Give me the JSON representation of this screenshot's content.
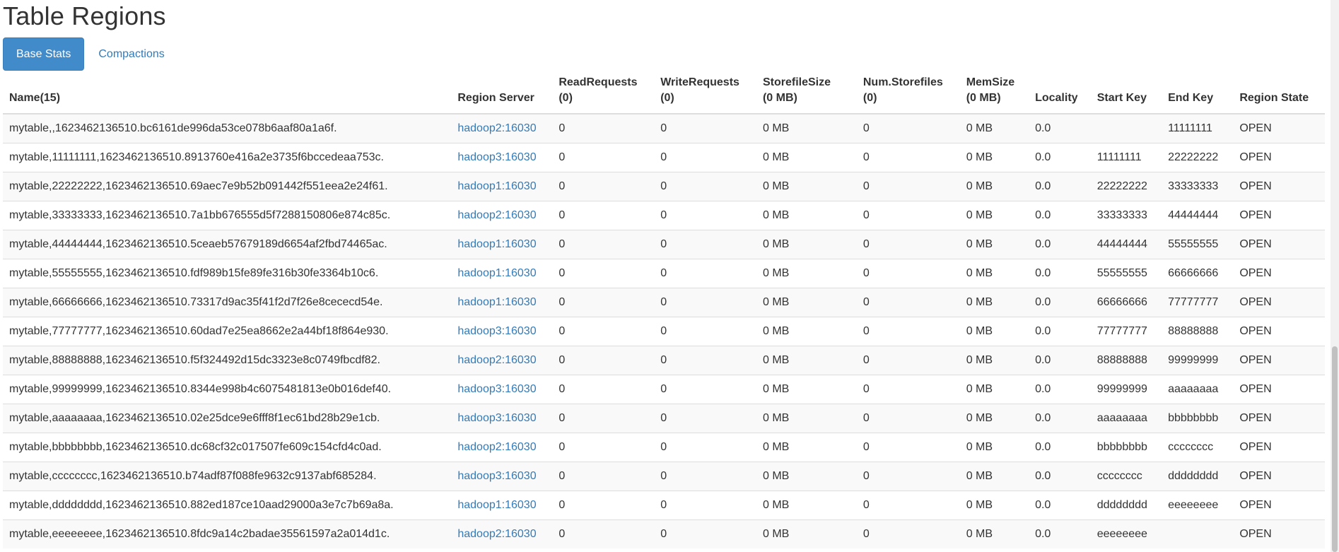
{
  "page": {
    "title": "Table Regions"
  },
  "tabs": [
    {
      "label": "Base Stats",
      "active": true
    },
    {
      "label": "Compactions",
      "active": false
    }
  ],
  "table": {
    "headers": {
      "name": "Name(15)",
      "server": "Region Server",
      "read_title": "ReadRequests",
      "read_sub": "(0)",
      "write_title": "WriteRequests",
      "write_sub": "(0)",
      "sfsize_title": "StorefileSize",
      "sfsize_sub": "(0 MB)",
      "numsf_title": "Num.Storefiles",
      "numsf_sub": "(0)",
      "mem_title": "MemSize",
      "mem_sub": "(0 MB)",
      "locality": "Locality",
      "start_key": "Start Key",
      "end_key": "End Key",
      "state": "Region State"
    },
    "rows": [
      {
        "name": "mytable,,1623462136510.bc6161de996da53ce078b6aaf80a1a6f.",
        "server": "hadoop2:16030",
        "read": "0",
        "write": "0",
        "sfsize": "0 MB",
        "numsf": "0",
        "mem": "0 MB",
        "locality": "0.0",
        "start": "",
        "end": "11111111",
        "state": "OPEN"
      },
      {
        "name": "mytable,11111111,1623462136510.8913760e416a2e3735f6bccedeaa753c.",
        "server": "hadoop3:16030",
        "read": "0",
        "write": "0",
        "sfsize": "0 MB",
        "numsf": "0",
        "mem": "0 MB",
        "locality": "0.0",
        "start": "11111111",
        "end": "22222222",
        "state": "OPEN"
      },
      {
        "name": "mytable,22222222,1623462136510.69aec7e9b52b091442f551eea2e24f61.",
        "server": "hadoop1:16030",
        "read": "0",
        "write": "0",
        "sfsize": "0 MB",
        "numsf": "0",
        "mem": "0 MB",
        "locality": "0.0",
        "start": "22222222",
        "end": "33333333",
        "state": "OPEN"
      },
      {
        "name": "mytable,33333333,1623462136510.7a1bb676555d5f7288150806e874c85c.",
        "server": "hadoop2:16030",
        "read": "0",
        "write": "0",
        "sfsize": "0 MB",
        "numsf": "0",
        "mem": "0 MB",
        "locality": "0.0",
        "start": "33333333",
        "end": "44444444",
        "state": "OPEN"
      },
      {
        "name": "mytable,44444444,1623462136510.5ceaeb57679189d6654af2fbd74465ac.",
        "server": "hadoop1:16030",
        "read": "0",
        "write": "0",
        "sfsize": "0 MB",
        "numsf": "0",
        "mem": "0 MB",
        "locality": "0.0",
        "start": "44444444",
        "end": "55555555",
        "state": "OPEN"
      },
      {
        "name": "mytable,55555555,1623462136510.fdf989b15fe89fe316b30fe3364b10c6.",
        "server": "hadoop1:16030",
        "read": "0",
        "write": "0",
        "sfsize": "0 MB",
        "numsf": "0",
        "mem": "0 MB",
        "locality": "0.0",
        "start": "55555555",
        "end": "66666666",
        "state": "OPEN"
      },
      {
        "name": "mytable,66666666,1623462136510.73317d9ac35f41f2d7f26e8cececd54e.",
        "server": "hadoop1:16030",
        "read": "0",
        "write": "0",
        "sfsize": "0 MB",
        "numsf": "0",
        "mem": "0 MB",
        "locality": "0.0",
        "start": "66666666",
        "end": "77777777",
        "state": "OPEN"
      },
      {
        "name": "mytable,77777777,1623462136510.60dad7e25ea8662e2a44bf18f864e930.",
        "server": "hadoop3:16030",
        "read": "0",
        "write": "0",
        "sfsize": "0 MB",
        "numsf": "0",
        "mem": "0 MB",
        "locality": "0.0",
        "start": "77777777",
        "end": "88888888",
        "state": "OPEN"
      },
      {
        "name": "mytable,88888888,1623462136510.f5f324492d15dc3323e8c0749fbcdf82.",
        "server": "hadoop2:16030",
        "read": "0",
        "write": "0",
        "sfsize": "0 MB",
        "numsf": "0",
        "mem": "0 MB",
        "locality": "0.0",
        "start": "88888888",
        "end": "99999999",
        "state": "OPEN"
      },
      {
        "name": "mytable,99999999,1623462136510.8344e998b4c6075481813e0b016def40.",
        "server": "hadoop3:16030",
        "read": "0",
        "write": "0",
        "sfsize": "0 MB",
        "numsf": "0",
        "mem": "0 MB",
        "locality": "0.0",
        "start": "99999999",
        "end": "aaaaaaaa",
        "state": "OPEN"
      },
      {
        "name": "mytable,aaaaaaaa,1623462136510.02e25dce9e6fff8f1ec61bd28b29e1cb.",
        "server": "hadoop3:16030",
        "read": "0",
        "write": "0",
        "sfsize": "0 MB",
        "numsf": "0",
        "mem": "0 MB",
        "locality": "0.0",
        "start": "aaaaaaaa",
        "end": "bbbbbbbb",
        "state": "OPEN"
      },
      {
        "name": "mytable,bbbbbbbb,1623462136510.dc68cf32c017507fe609c154cfd4c0ad.",
        "server": "hadoop2:16030",
        "read": "0",
        "write": "0",
        "sfsize": "0 MB",
        "numsf": "0",
        "mem": "0 MB",
        "locality": "0.0",
        "start": "bbbbbbbb",
        "end": "cccccccc",
        "state": "OPEN"
      },
      {
        "name": "mytable,cccccccc,1623462136510.b74adf87f088fe9632c9137abf685284.",
        "server": "hadoop3:16030",
        "read": "0",
        "write": "0",
        "sfsize": "0 MB",
        "numsf": "0",
        "mem": "0 MB",
        "locality": "0.0",
        "start": "cccccccc",
        "end": "dddddddd",
        "state": "OPEN"
      },
      {
        "name": "mytable,dddddddd,1623462136510.882ed187ce10aad29000a3e7c7b69a8a.",
        "server": "hadoop1:16030",
        "read": "0",
        "write": "0",
        "sfsize": "0 MB",
        "numsf": "0",
        "mem": "0 MB",
        "locality": "0.0",
        "start": "dddddddd",
        "end": "eeeeeeee",
        "state": "OPEN"
      },
      {
        "name": "mytable,eeeeeeee,1623462136510.8fdc9a14c2badae35561597a2a014d1c.",
        "server": "hadoop2:16030",
        "read": "0",
        "write": "0",
        "sfsize": "0 MB",
        "numsf": "0",
        "mem": "0 MB",
        "locality": "0.0",
        "start": "eeeeeeee",
        "end": "",
        "state": "OPEN"
      }
    ]
  },
  "colors": {
    "accent": "#428bca",
    "link": "#337ab7",
    "stripe": "#f9f9f9",
    "border": "#dddddd"
  }
}
